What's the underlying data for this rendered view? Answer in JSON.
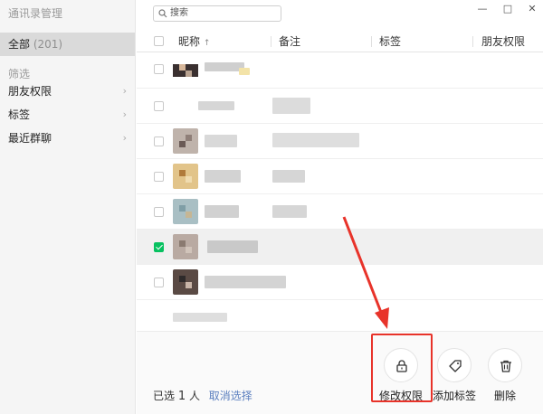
{
  "app": {
    "title": "通讯录管理"
  },
  "sidebar": {
    "all": {
      "label": "全部",
      "count": "(201)"
    },
    "section_title": "筛选",
    "items": [
      {
        "label": "朋友权限"
      },
      {
        "label": "标签"
      },
      {
        "label": "最近群聊"
      }
    ]
  },
  "search": {
    "placeholder": "搜索"
  },
  "window_controls": {
    "minimize": "—",
    "maximize": "□",
    "close": "✕"
  },
  "table": {
    "columns": [
      {
        "label": "昵称",
        "sort": "↑"
      },
      {
        "label": "备注"
      },
      {
        "label": "标签"
      },
      {
        "label": "朋友权限"
      }
    ]
  },
  "footer": {
    "selected_prefix": "已选",
    "selected_count": "1",
    "selected_unit": "人",
    "cancel_selection": "取消选择"
  },
  "actions": [
    {
      "label": "修改权限",
      "icon": "lock-icon"
    },
    {
      "label": "添加标签",
      "icon": "tag-icon"
    },
    {
      "label": "删除",
      "icon": "trash-icon"
    }
  ],
  "colors": {
    "accent_green": "#07c160",
    "link_blue": "#5b7fbf",
    "highlight_red": "#e8332a"
  }
}
